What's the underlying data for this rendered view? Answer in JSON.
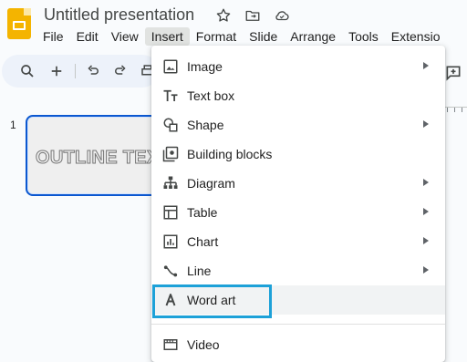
{
  "app": {
    "title": "Untitled presentation",
    "logo": "slides-logo"
  },
  "title_icons": [
    "star-icon",
    "move-to-folder-icon",
    "cloud-status-icon"
  ],
  "menubar": [
    {
      "label": "File"
    },
    {
      "label": "Edit"
    },
    {
      "label": "View"
    },
    {
      "label": "Insert",
      "active": true
    },
    {
      "label": "Format"
    },
    {
      "label": "Slide"
    },
    {
      "label": "Arrange"
    },
    {
      "label": "Tools"
    },
    {
      "label": "Extensio"
    }
  ],
  "toolbar": [
    "search-icon",
    "new-slide-icon",
    "undo-icon",
    "redo-icon",
    "print-icon"
  ],
  "filmstrip": {
    "slide_number": "1",
    "slide_text": "OUTLINE TEXT"
  },
  "insert_menu": {
    "items": [
      {
        "label": "Image",
        "icon": "image-icon",
        "submenu": true
      },
      {
        "label": "Text box",
        "icon": "text-box-icon",
        "submenu": false
      },
      {
        "label": "Shape",
        "icon": "shape-icon",
        "submenu": true
      },
      {
        "label": "Building blocks",
        "icon": "building-blocks-icon",
        "submenu": false
      },
      {
        "label": "Diagram",
        "icon": "diagram-icon",
        "submenu": true
      },
      {
        "label": "Table",
        "icon": "table-icon",
        "submenu": true
      },
      {
        "label": "Chart",
        "icon": "chart-icon",
        "submenu": true
      },
      {
        "label": "Line",
        "icon": "line-icon",
        "submenu": true
      },
      {
        "label": "Word art",
        "icon": "word-art-icon",
        "submenu": false,
        "highlighted": true
      },
      {
        "label": "Video",
        "icon": "video-icon",
        "submenu": false
      }
    ]
  },
  "colors": {
    "accent": "#0b57d0",
    "highlight_box": "#1da1d8",
    "logo": "#f4b400"
  }
}
